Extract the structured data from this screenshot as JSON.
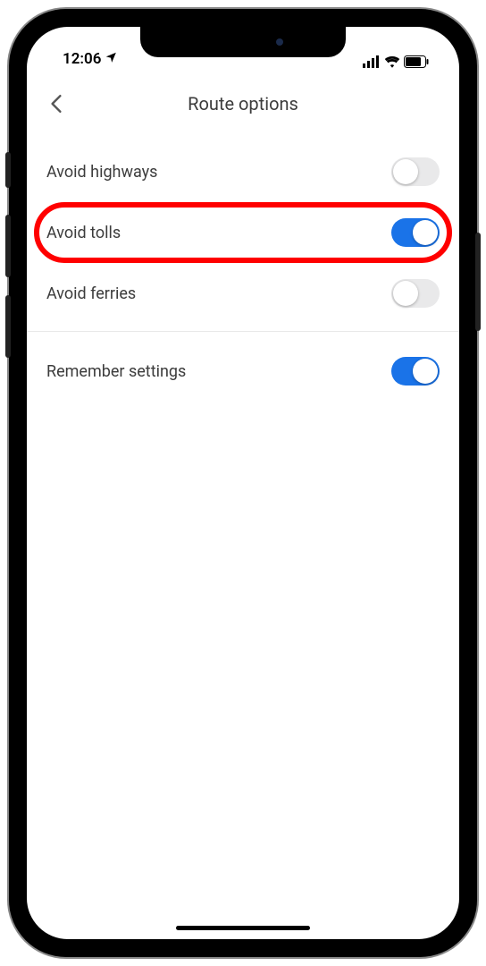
{
  "status": {
    "time": "12:06"
  },
  "header": {
    "title": "Route options"
  },
  "settings": {
    "section1": [
      {
        "label": "Avoid highways",
        "on": false,
        "highlight": false
      },
      {
        "label": "Avoid tolls",
        "on": true,
        "highlight": true
      },
      {
        "label": "Avoid ferries",
        "on": false,
        "highlight": false
      }
    ],
    "section2": [
      {
        "label": "Remember settings",
        "on": true,
        "highlight": false
      }
    ]
  },
  "colors": {
    "accent": "#1a73e8",
    "highlight": "#ff0000"
  }
}
